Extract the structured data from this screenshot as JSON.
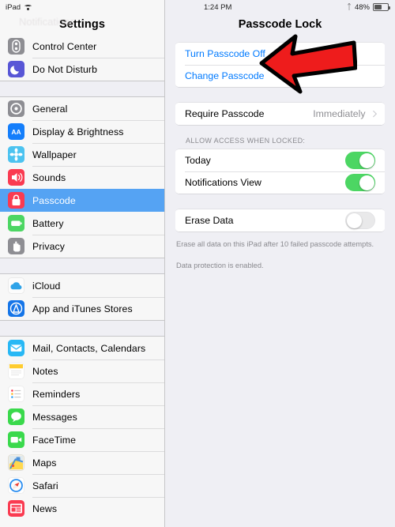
{
  "status_bar": {
    "device_label": "iPad",
    "wifi_icon": "wifi-icon",
    "time": "1:24 PM",
    "bluetooth_icon": "bluetooth-icon",
    "battery_percent": "48%",
    "battery_icon": "battery-icon"
  },
  "sidebar": {
    "title": "Settings",
    "ghost_back_label": "Notifications",
    "groups": [
      {
        "items": [
          {
            "label": "Control Center",
            "icon": "control-center-icon",
            "selected": false
          },
          {
            "label": "Do Not Disturb",
            "icon": "do-not-disturb-icon",
            "selected": false
          }
        ]
      },
      {
        "items": [
          {
            "label": "General",
            "icon": "general-icon",
            "selected": false
          },
          {
            "label": "Display & Brightness",
            "icon": "display-brightness-icon",
            "selected": false
          },
          {
            "label": "Wallpaper",
            "icon": "wallpaper-icon",
            "selected": false
          },
          {
            "label": "Sounds",
            "icon": "sounds-icon",
            "selected": false
          },
          {
            "label": "Passcode",
            "icon": "passcode-icon",
            "selected": true
          },
          {
            "label": "Battery",
            "icon": "battery-settings-icon",
            "selected": false
          },
          {
            "label": "Privacy",
            "icon": "privacy-icon",
            "selected": false
          }
        ]
      },
      {
        "items": [
          {
            "label": "iCloud",
            "icon": "icloud-icon",
            "selected": false
          },
          {
            "label": "App and iTunes Stores",
            "icon": "app-store-icon",
            "selected": false
          }
        ]
      },
      {
        "items": [
          {
            "label": "Mail, Contacts, Calendars",
            "icon": "mail-icon",
            "selected": false
          },
          {
            "label": "Notes",
            "icon": "notes-icon",
            "selected": false
          },
          {
            "label": "Reminders",
            "icon": "reminders-icon",
            "selected": false
          },
          {
            "label": "Messages",
            "icon": "messages-icon",
            "selected": false
          },
          {
            "label": "FaceTime",
            "icon": "facetime-icon",
            "selected": false
          },
          {
            "label": "Maps",
            "icon": "maps-icon",
            "selected": false
          },
          {
            "label": "Safari",
            "icon": "safari-icon",
            "selected": false
          },
          {
            "label": "News",
            "icon": "news-icon",
            "selected": false
          }
        ]
      }
    ]
  },
  "main": {
    "title": "Passcode Lock",
    "passcode_actions": {
      "turn_off_label": "Turn Passcode Off",
      "change_label": "Change Passcode"
    },
    "require_passcode": {
      "label": "Require Passcode",
      "value": "Immediately",
      "chevron_icon": "chevron-right-icon"
    },
    "allow_access_header": "ALLOW ACCESS WHEN LOCKED:",
    "allow_access_items": [
      {
        "label": "Today",
        "toggle_on": true
      },
      {
        "label": "Notifications View",
        "toggle_on": true
      }
    ],
    "erase_data": {
      "label": "Erase Data",
      "toggle_on": false
    },
    "footnotes": [
      "Erase all data on this iPad after 10 failed passcode attempts.",
      "Data protection is enabled."
    ]
  },
  "annotation": {
    "arrow_icon": "red-arrow-left-icon",
    "fill_color": "#ee1c1c",
    "stroke_color": "#000000"
  }
}
